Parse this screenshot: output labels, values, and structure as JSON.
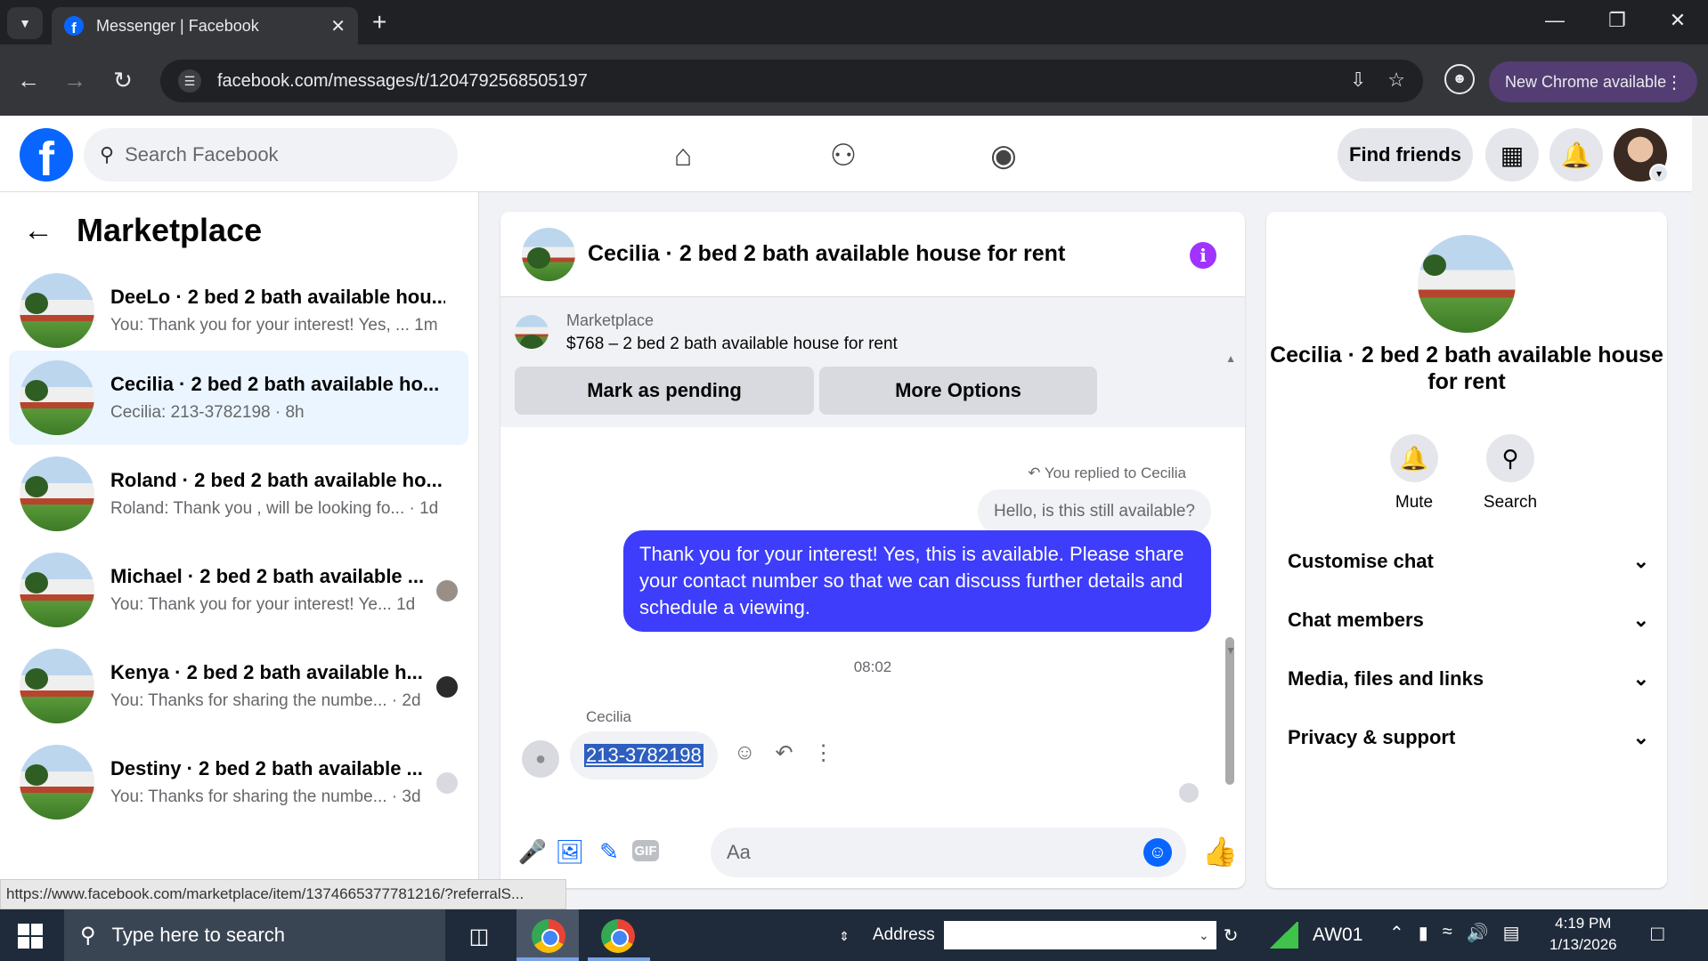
{
  "browser": {
    "tab_title": "Messenger | Facebook",
    "tab_favicon": "f",
    "url": "facebook.com/messages/t/1204792568505197",
    "new_chrome_label": "New Chrome available",
    "status_url": "https://www.facebook.com/marketplace/item/1374665377781216/?referralS..."
  },
  "fb_header": {
    "logo": "f",
    "search_placeholder": "Search Facebook",
    "find_friends_label": "Find friends",
    "icons": [
      "home-icon",
      "friends-icon",
      "groups-icon",
      "menu-grid-icon",
      "notifications-bell-icon"
    ]
  },
  "left_panel": {
    "title": "Marketplace",
    "conversations": [
      {
        "name": "DeeLo · 2 bed 2 bath available hou...",
        "preview": "You: Thank you for your interest! Yes, ... 1m",
        "active": false
      },
      {
        "name": "Cecilia · 2 bed 2 bath available ho...",
        "preview": "Cecilia: 213-3782198 · 8h",
        "active": true
      },
      {
        "name": "Roland · 2 bed 2 bath available ho...",
        "preview": "Roland: Thank you , will be looking fo... · 1d",
        "active": false
      },
      {
        "name": "Michael · 2 bed 2 bath available ...",
        "preview": "You: Thank you for your interest! Ye... 1d",
        "active": false
      },
      {
        "name": "Kenya · 2 bed 2 bath available h...",
        "preview": "You: Thanks for sharing the numbe... · 2d",
        "active": false
      },
      {
        "name": "Destiny · 2 bed 2 bath available ...",
        "preview": "You: Thanks for sharing the numbe... · 3d",
        "active": false
      }
    ]
  },
  "chat": {
    "title": "Cecilia · 2 bed 2 bath available house for rent",
    "marketplace_label": "Marketplace",
    "listing": "$768 – 2 bed 2 bath available house for rent",
    "mark_pending_label": "Mark as pending",
    "more_options_label": "More Options",
    "reply_note": "You replied to Cecilia",
    "quoted_message": "Hello, is this still available?",
    "my_message": "Thank you for your interest! Yes, this is available. Please share your contact number so that we can discuss further details and schedule a viewing.",
    "timestamp": "08:02",
    "sender_name": "Cecilia",
    "their_message": "213-3782198",
    "input_placeholder": "Aa"
  },
  "info_panel": {
    "title": "Cecilia · 2 bed 2 bath available house for rent",
    "mute_label": "Mute",
    "search_label": "Search",
    "sections": [
      "Customise chat",
      "Chat members",
      "Media, files and links",
      "Privacy & support"
    ]
  },
  "taskbar": {
    "search_placeholder": "Type here to search",
    "address_label": "Address",
    "network_label": "AW01",
    "time": "4:19 PM",
    "date": "1/13/2026"
  },
  "colors": {
    "fb_blue": "#0866ff",
    "my_bubble": "#3d3dfb",
    "active_row": "#ebf5ff",
    "info_purple": "#a033ff"
  }
}
